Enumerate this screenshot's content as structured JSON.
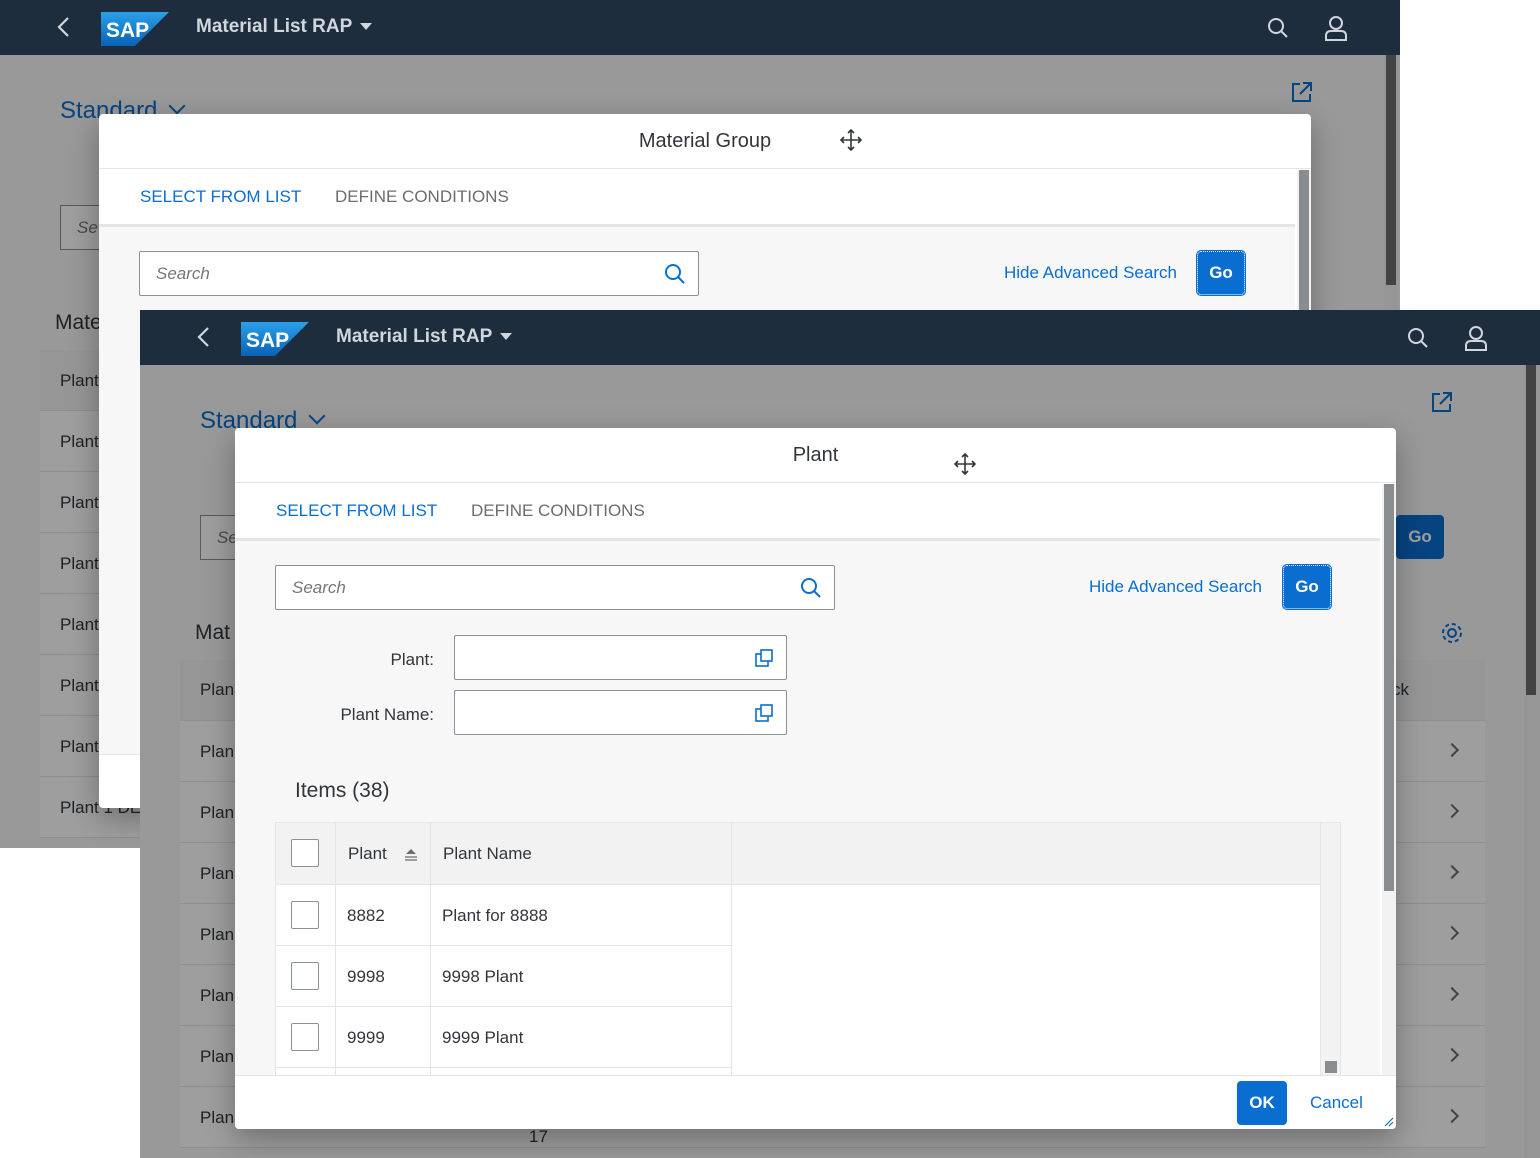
{
  "app": {
    "title": "Material List RAP",
    "variant": "Standard"
  },
  "back_window": {
    "dialog_title": "Material Group",
    "tabs": [
      "SELECT FROM LIST",
      "DEFINE CONDITIONS"
    ],
    "search_placeholder": "Search",
    "hide_advanced_label": "Hide Advanced Search",
    "go_label": "Go",
    "bg_search_placeholder": "Se",
    "bg_section_title": "Mate",
    "bg_rows": [
      "Plant",
      "Plant",
      "Plant",
      "Plant",
      "Plant",
      "Plant",
      "Plant",
      "Plant 1 DE"
    ]
  },
  "front_window": {
    "dialog_title": "Plant",
    "tabs": [
      "SELECT FROM LIST",
      "DEFINE CONDITIONS"
    ],
    "search_placeholder": "Search",
    "hide_advanced_label": "Hide Advanced Search",
    "go_label": "Go",
    "bg_go_label": "Go",
    "bg_search_placeholder": "Se",
    "bg_section_title": "Mat",
    "bg_column_right": "ck",
    "bg_rows": [
      "Plan",
      "Plan",
      "Plan",
      "Plan",
      "Plan",
      "Plan",
      "Plan",
      "Plan"
    ],
    "bg_footer_number": "17",
    "filters": [
      {
        "label": "Plant:",
        "value": ""
      },
      {
        "label": "Plant Name:",
        "value": ""
      }
    ],
    "items_title": "Items (38)",
    "table": {
      "columns": [
        "Plant",
        "Plant Name"
      ],
      "rows": [
        {
          "plant": "8882",
          "name": "Plant for 8888"
        },
        {
          "plant": "9998",
          "name": "9998 Plant"
        },
        {
          "plant": "9999",
          "name": "9999 Plant"
        }
      ]
    },
    "ok_label": "OK",
    "cancel_label": "Cancel"
  },
  "colors": {
    "shell": "#1d2d3e",
    "accent": "#0a6ed1",
    "text": "#32363a"
  }
}
